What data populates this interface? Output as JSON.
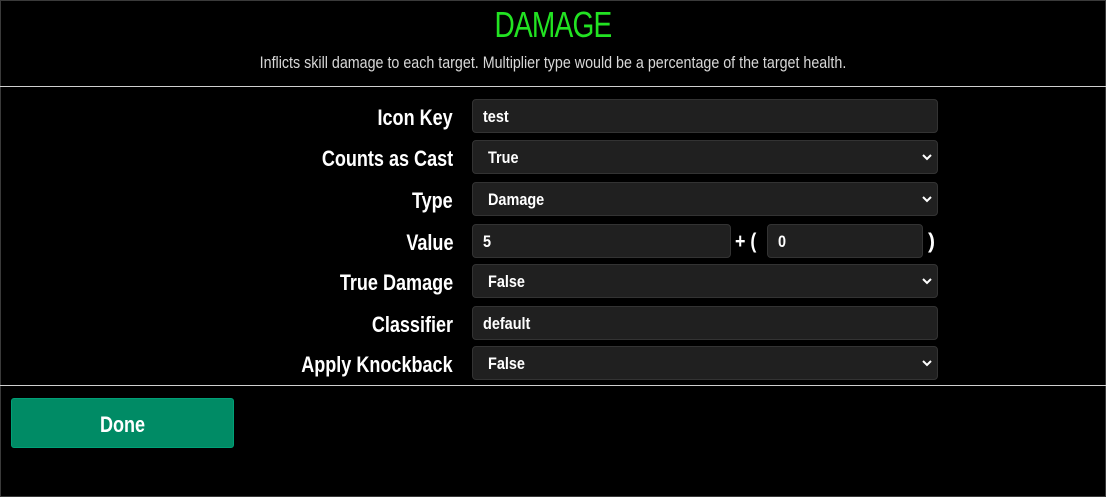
{
  "header": {
    "title": "DAMAGE",
    "subtitle": "Inflicts skill damage to each target. Multiplier type would be a percentage of the target health."
  },
  "colors": {
    "title": "#22e322",
    "done_button": "#008b65",
    "field_bg": "#202020"
  },
  "form": {
    "icon_key": {
      "label": "Icon Key",
      "value": "test"
    },
    "counts_as_cast": {
      "label": "Counts as Cast",
      "value": "True"
    },
    "type": {
      "label": "Type",
      "value": "Damage"
    },
    "value": {
      "label": "Value",
      "base": "5",
      "plus": "+ (",
      "extra": "0",
      "close": ")"
    },
    "true_damage": {
      "label": "True Damage",
      "value": "False"
    },
    "classifier": {
      "label": "Classifier",
      "value": "default"
    },
    "apply_knockback": {
      "label": "Apply Knockback",
      "value": "False"
    }
  },
  "footer": {
    "done_label": "Done"
  },
  "icons": {
    "dropdown": "chevron-down-icon"
  }
}
